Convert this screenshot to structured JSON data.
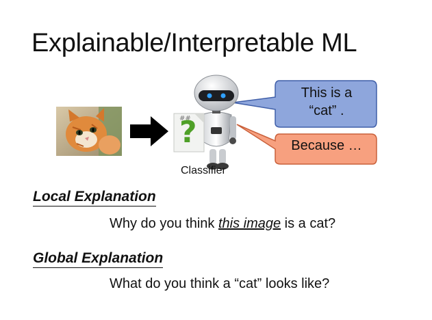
{
  "slide": {
    "title": "Explainable/Interpretable ML",
    "classifier_label": "Classifier",
    "classifier_symbol": "?",
    "speech_bubble_1": {
      "line1": "This is a",
      "line2": "“cat”  ."
    },
    "speech_bubble_2": "Because …",
    "local": {
      "heading": "Local Explanation",
      "question_before": "Why do you think ",
      "question_emph": "this image",
      "question_after": " is a cat?"
    },
    "global": {
      "heading": "Global Explanation",
      "question": "What do you think a “cat” looks like?"
    }
  },
  "colors": {
    "bubble_blue": "#8ea6dc",
    "bubble_orange": "#f7a07f",
    "question_mark": "#4fa028"
  }
}
